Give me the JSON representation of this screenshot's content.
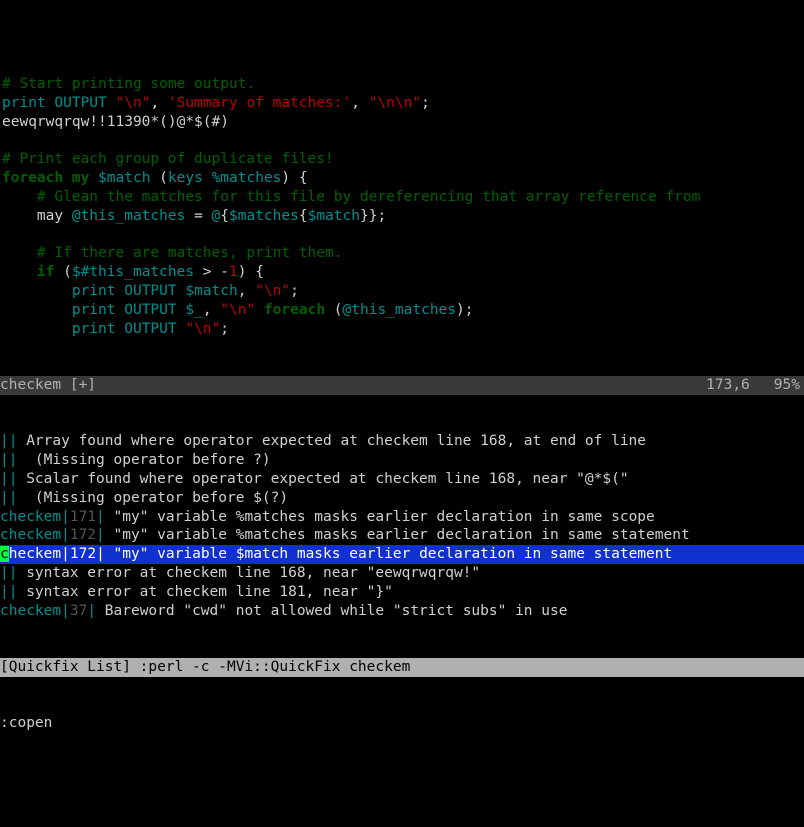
{
  "editor": {
    "lines": [
      {
        "type": "comment",
        "text": "# Start printing some output."
      },
      {
        "type": "code",
        "tokens": [
          {
            "cls": "print-kw",
            "t": "print"
          },
          {
            "cls": "op",
            "t": " "
          },
          {
            "cls": "ident",
            "t": "OUTPUT"
          },
          {
            "cls": "op",
            "t": " "
          },
          {
            "cls": "str",
            "t": "\"\\n\""
          },
          {
            "cls": "op",
            "t": ", "
          },
          {
            "cls": "str",
            "t": "'Summary of matches:'"
          },
          {
            "cls": "op",
            "t": ", "
          },
          {
            "cls": "str",
            "t": "\"\\n\\n\""
          },
          {
            "cls": "op",
            "t": ";"
          }
        ]
      },
      {
        "type": "code",
        "tokens": [
          {
            "cls": "op",
            "t": "eewqrwqrqw!!11390*()@*$(#)"
          }
        ]
      },
      {
        "type": "blank",
        "text": ""
      },
      {
        "type": "comment",
        "text": "# Print each group of duplicate files!"
      },
      {
        "type": "code",
        "tokens": [
          {
            "cls": "keyword",
            "t": "foreach"
          },
          {
            "cls": "op",
            "t": " "
          },
          {
            "cls": "keyword",
            "t": "my"
          },
          {
            "cls": "op",
            "t": " "
          },
          {
            "cls": "var",
            "t": "$match"
          },
          {
            "cls": "op",
            "t": " ("
          },
          {
            "cls": "func",
            "t": "keys"
          },
          {
            "cls": "op",
            "t": " "
          },
          {
            "cls": "var",
            "t": "%matches"
          },
          {
            "cls": "op",
            "t": ") {"
          }
        ]
      },
      {
        "type": "code",
        "indent": "    ",
        "tokens": [
          {
            "cls": "comment",
            "t": "# Glean the matches for this file by dereferencing that array reference from"
          }
        ]
      },
      {
        "type": "code",
        "indent": "    ",
        "tokens": [
          {
            "cls": "op",
            "t": "may "
          },
          {
            "cls": "var",
            "t": "@this_matches"
          },
          {
            "cls": "op",
            "t": " = "
          },
          {
            "cls": "var",
            "t": "@"
          },
          {
            "cls": "op",
            "t": "{"
          },
          {
            "cls": "var",
            "t": "$matches"
          },
          {
            "cls": "op",
            "t": "{"
          },
          {
            "cls": "var",
            "t": "$match"
          },
          {
            "cls": "op",
            "t": "}};"
          }
        ]
      },
      {
        "type": "blank",
        "text": ""
      },
      {
        "type": "code",
        "indent": "    ",
        "tokens": [
          {
            "cls": "comment",
            "t": "# If there are matches, print them."
          }
        ]
      },
      {
        "type": "code",
        "indent": "    ",
        "tokens": [
          {
            "cls": "keyword",
            "t": "if"
          },
          {
            "cls": "op",
            "t": " ("
          },
          {
            "cls": "var",
            "t": "$#this_matches"
          },
          {
            "cls": "op",
            "t": " > -"
          },
          {
            "cls": "str",
            "t": "1"
          },
          {
            "cls": "op",
            "t": ") {"
          }
        ]
      },
      {
        "type": "code",
        "indent": "        ",
        "tokens": [
          {
            "cls": "print-kw",
            "t": "print"
          },
          {
            "cls": "op",
            "t": " "
          },
          {
            "cls": "ident",
            "t": "OUTPUT"
          },
          {
            "cls": "op",
            "t": " "
          },
          {
            "cls": "var",
            "t": "$match"
          },
          {
            "cls": "op",
            "t": ", "
          },
          {
            "cls": "str",
            "t": "\"\\n\""
          },
          {
            "cls": "op",
            "t": ";"
          }
        ]
      },
      {
        "type": "code",
        "indent": "        ",
        "tokens": [
          {
            "cls": "print-kw",
            "t": "print"
          },
          {
            "cls": "op",
            "t": " "
          },
          {
            "cls": "ident",
            "t": "OUTPUT"
          },
          {
            "cls": "op",
            "t": " "
          },
          {
            "cls": "var",
            "t": "$_"
          },
          {
            "cls": "op",
            "t": ", "
          },
          {
            "cls": "str",
            "t": "\"\\n\""
          },
          {
            "cls": "op",
            "t": " "
          },
          {
            "cls": "keyword",
            "t": "foreach"
          },
          {
            "cls": "op",
            "t": " ("
          },
          {
            "cls": "var",
            "t": "@this_matches"
          },
          {
            "cls": "op",
            "t": ");"
          }
        ]
      },
      {
        "type": "code",
        "indent": "        ",
        "tokens": [
          {
            "cls": "print-kw",
            "t": "print"
          },
          {
            "cls": "op",
            "t": " "
          },
          {
            "cls": "ident",
            "t": "OUTPUT"
          },
          {
            "cls": "op",
            "t": " "
          },
          {
            "cls": "str",
            "t": "\"\\n\""
          },
          {
            "cls": "op",
            "t": ";"
          }
        ]
      }
    ]
  },
  "status_top": {
    "filename": "checkem",
    "modified": "[+]",
    "position": "173,6",
    "percent": "95%"
  },
  "quickfix": {
    "entries": [
      {
        "file": "",
        "line": "",
        "sep": "||",
        "text": " Array found where operator expected at checkem line 168, at end of line"
      },
      {
        "file": "",
        "line": "",
        "sep": "||",
        "text": "  (Missing operator before ?)"
      },
      {
        "file": "",
        "line": "",
        "sep": "||",
        "text": " Scalar found where operator expected at checkem line 168, near \"@*$(\""
      },
      {
        "file": "",
        "line": "",
        "sep": "||",
        "text": "  (Missing operator before $(?)"
      },
      {
        "file": "checkem",
        "line": "171",
        "sep": "|",
        "text": " \"my\" variable %matches masks earlier declaration in same scope"
      },
      {
        "file": "checkem",
        "line": "172",
        "sep": "|",
        "text": " \"my\" variable %matches masks earlier declaration in same statement"
      },
      {
        "file": "checkem",
        "line": "172",
        "sep": "|",
        "text": " \"my\" variable $match masks earlier declaration in same statement",
        "selected": true
      },
      {
        "file": "",
        "line": "",
        "sep": "||",
        "text": " syntax error at checkem line 168, near \"eewqrwqrqw!\""
      },
      {
        "file": "",
        "line": "",
        "sep": "||",
        "text": " syntax error at checkem line 181, near \"}\""
      },
      {
        "file": "checkem",
        "line": "37",
        "sep": "|",
        "text": " Bareword \"cwd\" not allowed while \"strict subs\" in use"
      }
    ]
  },
  "status_bottom": {
    "label": "[Quickfix List] :perl -c -MVi::QuickFix checkem"
  },
  "cmdline": ":copen"
}
